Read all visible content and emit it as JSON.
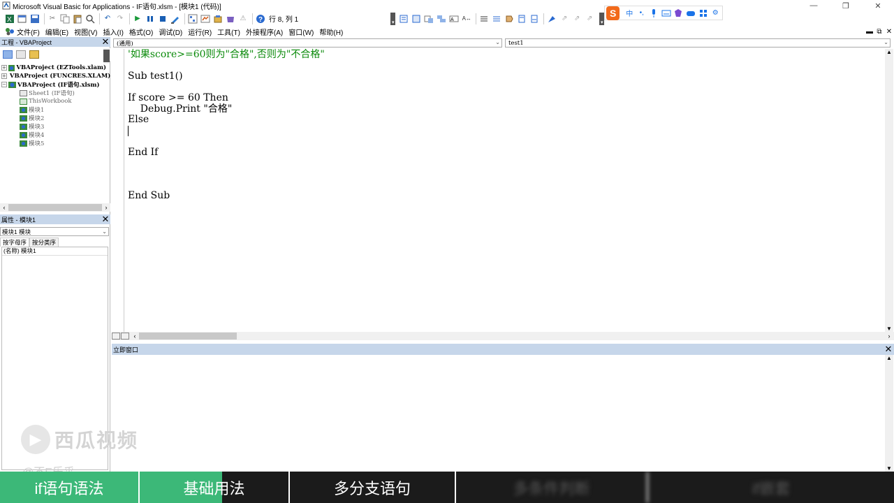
{
  "window": {
    "title": "Microsoft Visual Basic for Applications - IF语句.xlsm - [模块1 (代码)]"
  },
  "toolbar": {
    "position": "行 8, 列 1"
  },
  "menu": [
    "文件(F)",
    "编辑(E)",
    "视图(V)",
    "插入(I)",
    "格式(O)",
    "调试(D)",
    "运行(R)",
    "工具(T)",
    "外接程序(A)",
    "窗口(W)",
    "帮助(H)"
  ],
  "ime": {
    "logo": "S",
    "mode": "中"
  },
  "project": {
    "header": "工程 - VBAProject",
    "nodes": [
      {
        "label": "VBAProject (EZTools.xlam)",
        "toggle": "+",
        "indent": 0
      },
      {
        "label": "VBAProject (FUNCRES.XLAM)",
        "toggle": "+",
        "indent": 0
      },
      {
        "label": "VBAProject (IF语句.xlsm)",
        "toggle": "−",
        "indent": 0
      },
      {
        "label": "Sheet1 (IF语句)",
        "toggle": "",
        "indent": 1
      },
      {
        "label": "ThisWorkbook",
        "toggle": "",
        "indent": 1
      },
      {
        "label": "模块1",
        "toggle": "",
        "indent": 1
      },
      {
        "label": "模块2",
        "toggle": "",
        "indent": 1
      },
      {
        "label": "模块3",
        "toggle": "",
        "indent": 1
      },
      {
        "label": "模块4",
        "toggle": "",
        "indent": 1
      },
      {
        "label": "模块5",
        "toggle": "",
        "indent": 1
      }
    ]
  },
  "properties": {
    "header": "属性 - 模块1",
    "object": "模块1 模块",
    "tab_alpha": "按字母序",
    "tab_category": "按分类序",
    "row": "(名称) 模块1"
  },
  "code": {
    "object_combo": "(通用)",
    "proc_combo": "test1",
    "lines": [
      "'如果score>=60则为\"合格\",否则为\"不合格\"",
      "",
      "Sub test1()",
      "",
      "If score >= 60 Then",
      "    Debug.Print \"合格\"",
      "Else",
      "",
      "",
      "End If",
      "",
      "",
      "",
      "End Sub"
    ]
  },
  "immediate": {
    "header": "立即窗口"
  },
  "overlay": {
    "watermark": "西瓜视频",
    "author": "@不E乐乎"
  },
  "chapters": [
    {
      "label": "if语句语法",
      "state": "done"
    },
    {
      "label": "基础用法",
      "state": "part"
    },
    {
      "label": "多分支语句",
      "state": "next"
    },
    {
      "label": "多条件判断",
      "state": "dim"
    },
    {
      "label": "if嵌套",
      "state": "dim"
    }
  ]
}
